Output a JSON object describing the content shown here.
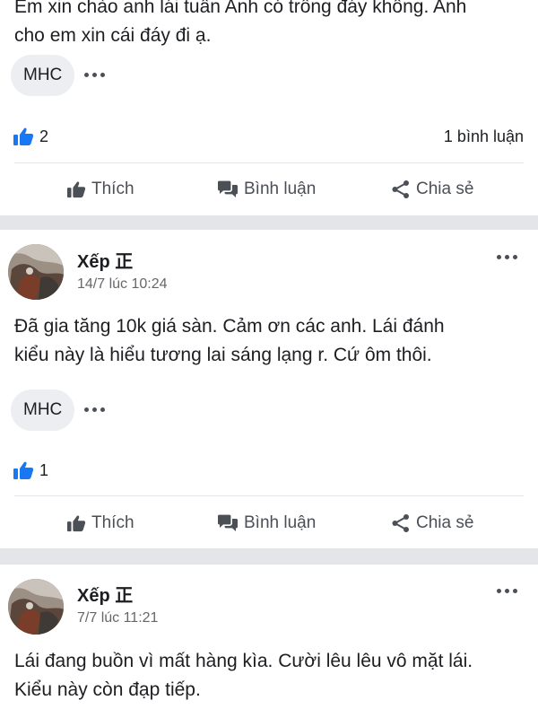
{
  "top_post": {
    "body_lines": [
      "Em xin chào anh lái tuần Anh có trồng đáy không. Anh",
      "cho em xin cái đáy đi ạ."
    ],
    "chip_label": "MHC",
    "like_count": "2",
    "comment_count": "1 bình luận"
  },
  "actions": {
    "like": "Thích",
    "comment": "Bình luận",
    "share": "Chia sẻ"
  },
  "post1": {
    "author": "Xếp 正",
    "time": "14/7 lúc 10:24",
    "body_lines": [
      "Đã gia tăng 10k giá sàn. Cảm ơn các anh. Lái đánh",
      "kiểu này là hiểu tương lai sáng lạng r. Cứ ôm thôi."
    ],
    "chip_label": "MHC",
    "like_count": "1"
  },
  "post2": {
    "author": "Xếp 正",
    "time": "7/7 lúc 11:21",
    "body_lines": [
      "Lái đang buồn vì mất hàng kìa. Cười lêu lêu vô mặt lái.",
      "Kiểu này còn đạp tiếp."
    ]
  },
  "colors": {
    "like_blue": "#1877f2",
    "band_gray": "#e4e5e9",
    "action_gray": "#4b4f56"
  },
  "icons": [
    "thumbs-up-icon",
    "comment-icon",
    "share-icon",
    "more-icon"
  ]
}
